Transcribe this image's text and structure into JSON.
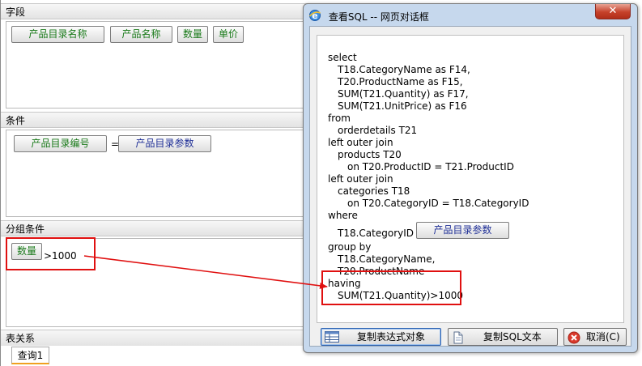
{
  "designer": {
    "fields_section": {
      "title": "字段",
      "fields": [
        "产品目录名称",
        "产品名称",
        "数量",
        "单价"
      ]
    },
    "condition_section": {
      "title": "条件",
      "left_field": "产品目录编号",
      "operator": "=",
      "param": "产品目录参数"
    },
    "group_condition_section": {
      "title": "分组条件",
      "field": "数量",
      "expression": ">1000"
    },
    "relation_section": {
      "title": "表关系",
      "tab": "查询1"
    }
  },
  "dialog": {
    "title": "查看SQL -- 网页对话框",
    "close_glyph": "✕",
    "sql_lines": [
      "select",
      "T18.CategoryName as F14,",
      "T20.ProductName as F15,",
      "SUM(T21.Quantity) as F17,",
      "SUM(T21.UnitPrice) as F16",
      "from",
      "orderdetails T21",
      "left outer join",
      "products T20",
      "on T20.ProductID = T21.ProductID",
      "left outer join",
      "categories T18",
      "on T20.CategoryID = T18.CategoryID",
      "where",
      "T18.CategoryID =",
      "group by",
      "T18.CategoryName,",
      "T20.ProductName",
      "having",
      "SUM(T21.Quantity)>1000"
    ],
    "where_param": "产品目录参数",
    "buttons": {
      "copy_expression": "复制表达式对象",
      "copy_sql": "复制SQL文本",
      "cancel": "取消(C)"
    }
  },
  "annotation": {
    "color": "#e01010"
  }
}
